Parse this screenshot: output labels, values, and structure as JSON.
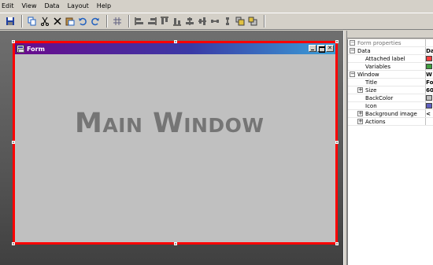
{
  "menu": {
    "items": [
      "Edit",
      "View",
      "Data",
      "Layout",
      "Help"
    ]
  },
  "toolbar": {
    "icons": [
      "save-icon",
      "copy-icon",
      "cut-icon",
      "delete-icon",
      "paste-icon",
      "undo-icon",
      "redo-icon",
      "grid-icon",
      "align-left-icon",
      "align-right-icon",
      "align-top-icon",
      "align-bottom-icon",
      "center-horizontal-icon",
      "center-vertical-icon",
      "space-horizontal-icon",
      "space-vertical-icon",
      "bring-front-icon",
      "send-back-icon"
    ]
  },
  "form": {
    "title": "Form",
    "main_text": "Main Window"
  },
  "properties": {
    "header": "Form properties",
    "data_category": "Data",
    "data_value": "Da",
    "attached_label": "Attached label",
    "variables": "Variables",
    "window_category": "Window",
    "window_value": "W",
    "title_label": "Title",
    "title_value": "Fo",
    "size_label": "Size",
    "size_value": "60",
    "backcolor_label": "BackColor",
    "icon_label": "Icon",
    "background_image_label": "Background image",
    "background_image_value": "<",
    "actions_label": "Actions"
  },
  "colors": {
    "selection_border": "#ff0000",
    "titlebar_start": "#6a0a8c",
    "titlebar_end": "#3aa0d8",
    "form_background": "#c0c0c0",
    "main_text": "#757575"
  }
}
